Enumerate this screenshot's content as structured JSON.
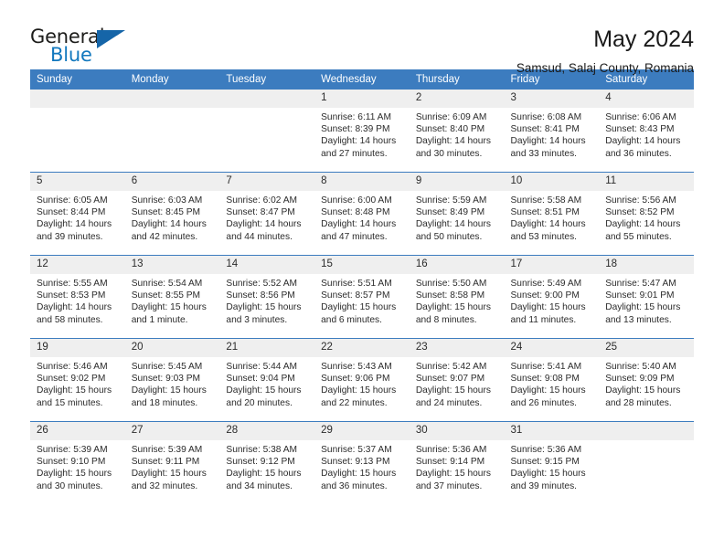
{
  "brand": {
    "name_top": "General",
    "name_bottom": "Blue",
    "accent_color": "#1565a8",
    "blue_text_color": "#1278be"
  },
  "header": {
    "title": "May 2024",
    "subtitle": "Samsud, Salaj County, Romania"
  },
  "colors": {
    "header_row_bg": "#3c7cbf",
    "header_row_text": "#ffffff",
    "daynum_bg": "#efefef",
    "grid_line": "#3c7cbf",
    "body_text": "#2b2b2b"
  },
  "weekday_headers": [
    "Sunday",
    "Monday",
    "Tuesday",
    "Wednesday",
    "Thursday",
    "Friday",
    "Saturday"
  ],
  "labels": {
    "sunrise_prefix": "Sunrise:",
    "sunset_prefix": "Sunset:",
    "daylight_prefix": "Daylight:"
  },
  "weeks": [
    [
      {
        "day": "",
        "empty": true
      },
      {
        "day": "",
        "empty": true
      },
      {
        "day": "",
        "empty": true
      },
      {
        "day": "1",
        "sunrise": "Sunrise: 6:11 AM",
        "sunset": "Sunset: 8:39 PM",
        "daylight_line1": "Daylight: 14 hours",
        "daylight_line2": "and 27 minutes."
      },
      {
        "day": "2",
        "sunrise": "Sunrise: 6:09 AM",
        "sunset": "Sunset: 8:40 PM",
        "daylight_line1": "Daylight: 14 hours",
        "daylight_line2": "and 30 minutes."
      },
      {
        "day": "3",
        "sunrise": "Sunrise: 6:08 AM",
        "sunset": "Sunset: 8:41 PM",
        "daylight_line1": "Daylight: 14 hours",
        "daylight_line2": "and 33 minutes."
      },
      {
        "day": "4",
        "sunrise": "Sunrise: 6:06 AM",
        "sunset": "Sunset: 8:43 PM",
        "daylight_line1": "Daylight: 14 hours",
        "daylight_line2": "and 36 minutes."
      }
    ],
    [
      {
        "day": "5",
        "sunrise": "Sunrise: 6:05 AM",
        "sunset": "Sunset: 8:44 PM",
        "daylight_line1": "Daylight: 14 hours",
        "daylight_line2": "and 39 minutes."
      },
      {
        "day": "6",
        "sunrise": "Sunrise: 6:03 AM",
        "sunset": "Sunset: 8:45 PM",
        "daylight_line1": "Daylight: 14 hours",
        "daylight_line2": "and 42 minutes."
      },
      {
        "day": "7",
        "sunrise": "Sunrise: 6:02 AM",
        "sunset": "Sunset: 8:47 PM",
        "daylight_line1": "Daylight: 14 hours",
        "daylight_line2": "and 44 minutes."
      },
      {
        "day": "8",
        "sunrise": "Sunrise: 6:00 AM",
        "sunset": "Sunset: 8:48 PM",
        "daylight_line1": "Daylight: 14 hours",
        "daylight_line2": "and 47 minutes."
      },
      {
        "day": "9",
        "sunrise": "Sunrise: 5:59 AM",
        "sunset": "Sunset: 8:49 PM",
        "daylight_line1": "Daylight: 14 hours",
        "daylight_line2": "and 50 minutes."
      },
      {
        "day": "10",
        "sunrise": "Sunrise: 5:58 AM",
        "sunset": "Sunset: 8:51 PM",
        "daylight_line1": "Daylight: 14 hours",
        "daylight_line2": "and 53 minutes."
      },
      {
        "day": "11",
        "sunrise": "Sunrise: 5:56 AM",
        "sunset": "Sunset: 8:52 PM",
        "daylight_line1": "Daylight: 14 hours",
        "daylight_line2": "and 55 minutes."
      }
    ],
    [
      {
        "day": "12",
        "sunrise": "Sunrise: 5:55 AM",
        "sunset": "Sunset: 8:53 PM",
        "daylight_line1": "Daylight: 14 hours",
        "daylight_line2": "and 58 minutes."
      },
      {
        "day": "13",
        "sunrise": "Sunrise: 5:54 AM",
        "sunset": "Sunset: 8:55 PM",
        "daylight_line1": "Daylight: 15 hours",
        "daylight_line2": "and 1 minute."
      },
      {
        "day": "14",
        "sunrise": "Sunrise: 5:52 AM",
        "sunset": "Sunset: 8:56 PM",
        "daylight_line1": "Daylight: 15 hours",
        "daylight_line2": "and 3 minutes."
      },
      {
        "day": "15",
        "sunrise": "Sunrise: 5:51 AM",
        "sunset": "Sunset: 8:57 PM",
        "daylight_line1": "Daylight: 15 hours",
        "daylight_line2": "and 6 minutes."
      },
      {
        "day": "16",
        "sunrise": "Sunrise: 5:50 AM",
        "sunset": "Sunset: 8:58 PM",
        "daylight_line1": "Daylight: 15 hours",
        "daylight_line2": "and 8 minutes."
      },
      {
        "day": "17",
        "sunrise": "Sunrise: 5:49 AM",
        "sunset": "Sunset: 9:00 PM",
        "daylight_line1": "Daylight: 15 hours",
        "daylight_line2": "and 11 minutes."
      },
      {
        "day": "18",
        "sunrise": "Sunrise: 5:47 AM",
        "sunset": "Sunset: 9:01 PM",
        "daylight_line1": "Daylight: 15 hours",
        "daylight_line2": "and 13 minutes."
      }
    ],
    [
      {
        "day": "19",
        "sunrise": "Sunrise: 5:46 AM",
        "sunset": "Sunset: 9:02 PM",
        "daylight_line1": "Daylight: 15 hours",
        "daylight_line2": "and 15 minutes."
      },
      {
        "day": "20",
        "sunrise": "Sunrise: 5:45 AM",
        "sunset": "Sunset: 9:03 PM",
        "daylight_line1": "Daylight: 15 hours",
        "daylight_line2": "and 18 minutes."
      },
      {
        "day": "21",
        "sunrise": "Sunrise: 5:44 AM",
        "sunset": "Sunset: 9:04 PM",
        "daylight_line1": "Daylight: 15 hours",
        "daylight_line2": "and 20 minutes."
      },
      {
        "day": "22",
        "sunrise": "Sunrise: 5:43 AM",
        "sunset": "Sunset: 9:06 PM",
        "daylight_line1": "Daylight: 15 hours",
        "daylight_line2": "and 22 minutes."
      },
      {
        "day": "23",
        "sunrise": "Sunrise: 5:42 AM",
        "sunset": "Sunset: 9:07 PM",
        "daylight_line1": "Daylight: 15 hours",
        "daylight_line2": "and 24 minutes."
      },
      {
        "day": "24",
        "sunrise": "Sunrise: 5:41 AM",
        "sunset": "Sunset: 9:08 PM",
        "daylight_line1": "Daylight: 15 hours",
        "daylight_line2": "and 26 minutes."
      },
      {
        "day": "25",
        "sunrise": "Sunrise: 5:40 AM",
        "sunset": "Sunset: 9:09 PM",
        "daylight_line1": "Daylight: 15 hours",
        "daylight_line2": "and 28 minutes."
      }
    ],
    [
      {
        "day": "26",
        "sunrise": "Sunrise: 5:39 AM",
        "sunset": "Sunset: 9:10 PM",
        "daylight_line1": "Daylight: 15 hours",
        "daylight_line2": "and 30 minutes."
      },
      {
        "day": "27",
        "sunrise": "Sunrise: 5:39 AM",
        "sunset": "Sunset: 9:11 PM",
        "daylight_line1": "Daylight: 15 hours",
        "daylight_line2": "and 32 minutes."
      },
      {
        "day": "28",
        "sunrise": "Sunrise: 5:38 AM",
        "sunset": "Sunset: 9:12 PM",
        "daylight_line1": "Daylight: 15 hours",
        "daylight_line2": "and 34 minutes."
      },
      {
        "day": "29",
        "sunrise": "Sunrise: 5:37 AM",
        "sunset": "Sunset: 9:13 PM",
        "daylight_line1": "Daylight: 15 hours",
        "daylight_line2": "and 36 minutes."
      },
      {
        "day": "30",
        "sunrise": "Sunrise: 5:36 AM",
        "sunset": "Sunset: 9:14 PM",
        "daylight_line1": "Daylight: 15 hours",
        "daylight_line2": "and 37 minutes."
      },
      {
        "day": "31",
        "sunrise": "Sunrise: 5:36 AM",
        "sunset": "Sunset: 9:15 PM",
        "daylight_line1": "Daylight: 15 hours",
        "daylight_line2": "and 39 minutes."
      },
      {
        "day": "",
        "empty": true
      }
    ]
  ]
}
